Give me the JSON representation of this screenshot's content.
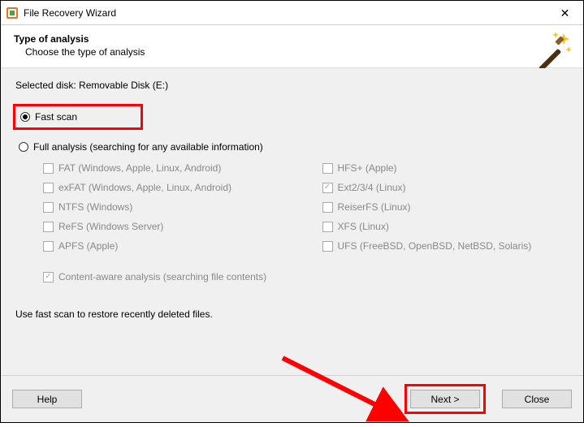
{
  "window": {
    "title": "File Recovery Wizard"
  },
  "header": {
    "title": "Type of analysis",
    "subtitle": "Choose the type of analysis"
  },
  "selected_disk_label": "Selected disk: Removable Disk (E:)",
  "options": {
    "fast_scan": "Fast scan",
    "full_analysis": "Full analysis (searching for any available information)"
  },
  "filesystems": {
    "left": [
      {
        "label": "FAT (Windows, Apple, Linux, Android)",
        "checked": false
      },
      {
        "label": "exFAT (Windows, Apple, Linux, Android)",
        "checked": false
      },
      {
        "label": "NTFS (Windows)",
        "checked": false
      },
      {
        "label": "ReFS (Windows Server)",
        "checked": false
      },
      {
        "label": "APFS (Apple)",
        "checked": false
      }
    ],
    "right": [
      {
        "label": "HFS+ (Apple)",
        "checked": false
      },
      {
        "label": "Ext2/3/4 (Linux)",
        "checked": true
      },
      {
        "label": "ReiserFS (Linux)",
        "checked": false
      },
      {
        "label": "XFS (Linux)",
        "checked": false
      },
      {
        "label": "UFS (FreeBSD, OpenBSD, NetBSD, Solaris)",
        "checked": false
      }
    ]
  },
  "content_aware_label": "Content-aware analysis (searching file contents)",
  "hint": "Use fast scan to restore recently deleted files.",
  "buttons": {
    "help": "Help",
    "next": "Next >",
    "close": "Close"
  }
}
